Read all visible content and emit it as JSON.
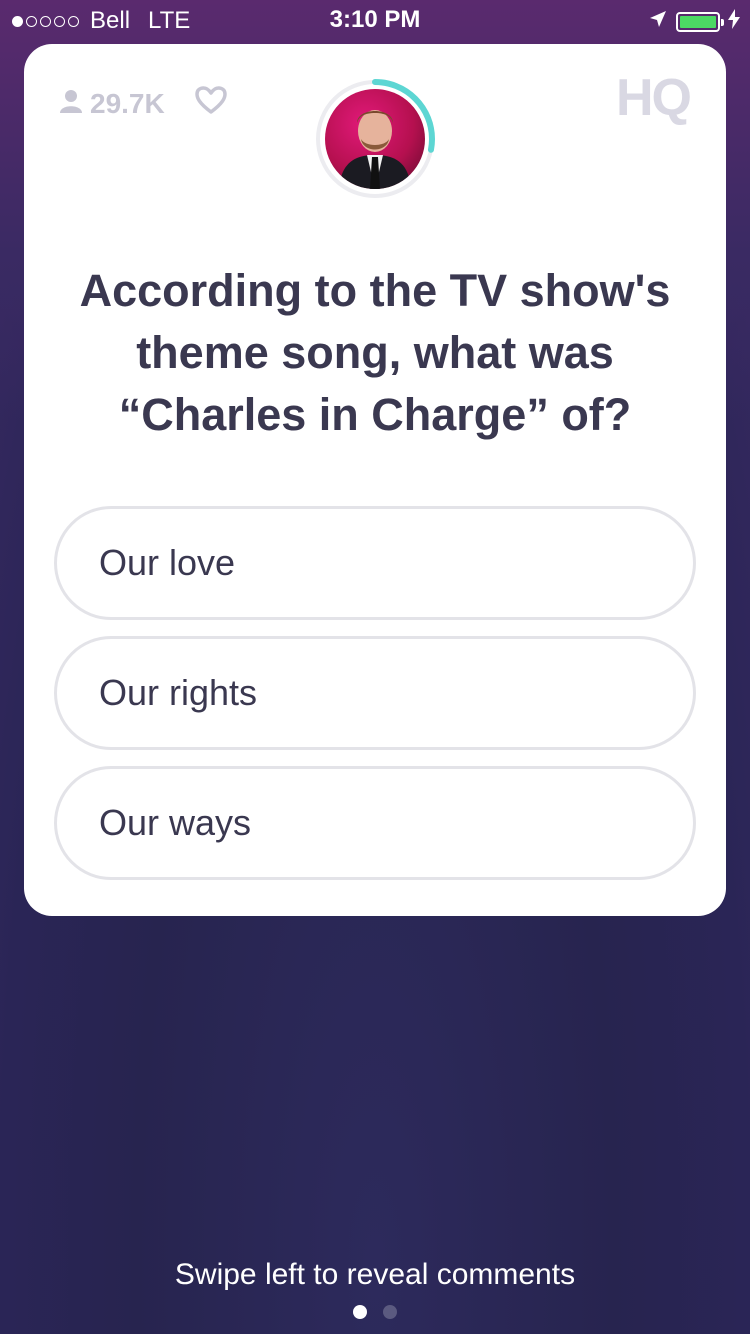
{
  "status_bar": {
    "carrier": "Bell",
    "network": "LTE",
    "time": "3:10 PM",
    "signal_bars": 1,
    "signal_total": 5,
    "battery_color": "#4cd964",
    "icons": [
      "location-arrow-icon",
      "battery-icon",
      "charging-bolt-icon"
    ]
  },
  "header": {
    "viewer_count": "29.7K",
    "viewer_icon": "user-icon",
    "heart_icon": "heart-icon",
    "logo": "HQ",
    "timer_color": "#5dd6d3",
    "timer_remaining_fraction": 0.28
  },
  "question": {
    "line1": "According to the TV show's",
    "line2": "theme song, what was",
    "line3": "“Charles in Charge” of?"
  },
  "answers": [
    {
      "label": "Our love"
    },
    {
      "label": "Our rights"
    },
    {
      "label": "Our ways"
    }
  ],
  "footer": {
    "hint": "Swipe left to reveal comments",
    "page_count": 2,
    "active_page": 1
  },
  "colors": {
    "text_dark": "#3a3850",
    "muted": "#c7c6d3",
    "background": "#27244f"
  }
}
